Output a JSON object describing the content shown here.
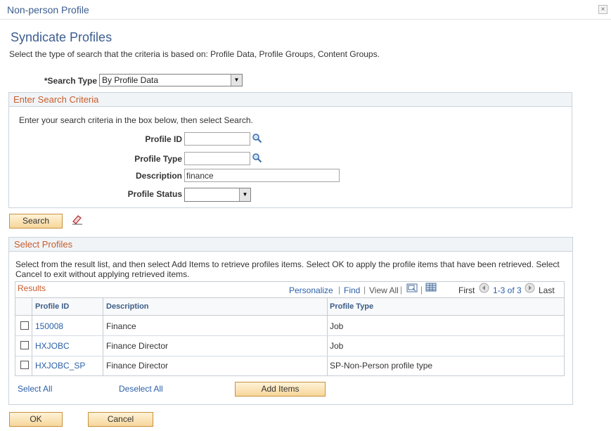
{
  "window": {
    "title": "Non-person Profile",
    "close_glyph": "×"
  },
  "page": {
    "title": "Syndicate Profiles",
    "instruction": "Select the type of search that the criteria is based on: Profile Data, Profile Groups, Content Groups."
  },
  "search_type": {
    "label": "*Search Type",
    "value": "By Profile Data"
  },
  "criteria": {
    "title": "Enter Search Criteria",
    "instruction": "Enter your search criteria in the box below, then select Search.",
    "profile_id_label": "Profile ID",
    "profile_id_value": "",
    "profile_type_label": "Profile Type",
    "profile_type_value": "",
    "description_label": "Description",
    "description_value": "finance",
    "status_label": "Profile Status",
    "status_value": ""
  },
  "search_button": "Search",
  "select_profiles": {
    "title": "Select Profiles",
    "instruction": "Select from the result list, and then select Add Items to retrieve profiles items. Select OK to apply the profile items that have been retrieved. Select Cancel to exit without applying retrieved items."
  },
  "results": {
    "title": "Results",
    "personalize": "Personalize",
    "find": "Find",
    "view_all": "View All",
    "first": "First",
    "range": "1-3 of 3",
    "last": "Last",
    "columns": [
      "Profile ID",
      "Description",
      "Profile Type"
    ],
    "rows": [
      {
        "id": "150008",
        "description": "Finance",
        "type": "Job"
      },
      {
        "id": "HXJOBC",
        "description": "Finance Director",
        "type": "Job"
      },
      {
        "id": "HXJOBC_SP",
        "description": "Finance Director",
        "type": "SP-Non-Person profile type"
      }
    ],
    "select_all": "Select All",
    "deselect_all": "Deselect All",
    "add_items": "Add Items"
  },
  "footer": {
    "ok": "OK",
    "cancel": "Cancel"
  },
  "colors": {
    "accent": "#3c5d8f",
    "group_title": "#c75c2b",
    "link": "#2b5fa8",
    "button": "#f6d69a"
  },
  "icons": [
    "magnifier-icon",
    "eraser-icon",
    "zoom-grid-icon",
    "spreadsheet-icon",
    "arrow-left-icon",
    "arrow-right-icon",
    "close-icon"
  ]
}
